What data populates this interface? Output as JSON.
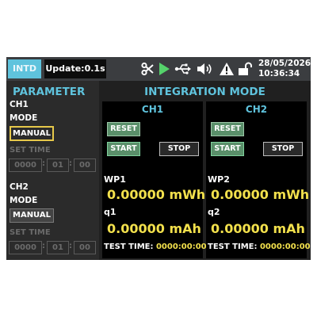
{
  "topbar": {
    "mode_badge": "INTD",
    "update_label": "Update:0.1s",
    "date": "28/05/2026",
    "time": "10:36:34",
    "icons": [
      "scissors-icon",
      "play-icon",
      "usb-icon",
      "speaker-icon",
      "warning-icon",
      "unlock-icon"
    ],
    "colors": {
      "badge": "#5fc3dd",
      "play": "#55d26b"
    }
  },
  "parameter": {
    "title": "PARAMETER",
    "ch1": {
      "label": "CH1",
      "mode_label": "MODE",
      "mode_value": "MANUAL",
      "set_time_label": "SET TIME",
      "time": [
        "0000",
        "01",
        "00"
      ]
    },
    "ch2": {
      "label": "CH2",
      "mode_label": "MODE",
      "mode_value": "MANUAL",
      "set_time_label": "SET TIME",
      "time": [
        "0000",
        "01",
        "00"
      ]
    }
  },
  "integration": {
    "title": "INTEGRATION MODE",
    "channels": [
      {
        "title": "CH1",
        "reset_label": "RESET",
        "start_label": "START",
        "stop_label": "STOP",
        "wp_label": "WP1",
        "wp_value": "0.00000 mWh",
        "q_label": "q1",
        "q_value": "0.00000 mAh",
        "test_time_label": "TEST TIME:",
        "test_time_value": "0000:00:00"
      },
      {
        "title": "CH2",
        "reset_label": "RESET",
        "start_label": "START",
        "stop_label": "STOP",
        "wp_label": "WP2",
        "wp_value": "0.00000 mWh",
        "q_label": "q2",
        "q_value": "0.00000 mAh",
        "test_time_label": "TEST TIME:",
        "test_time_value": "0000:00:00"
      }
    ]
  }
}
